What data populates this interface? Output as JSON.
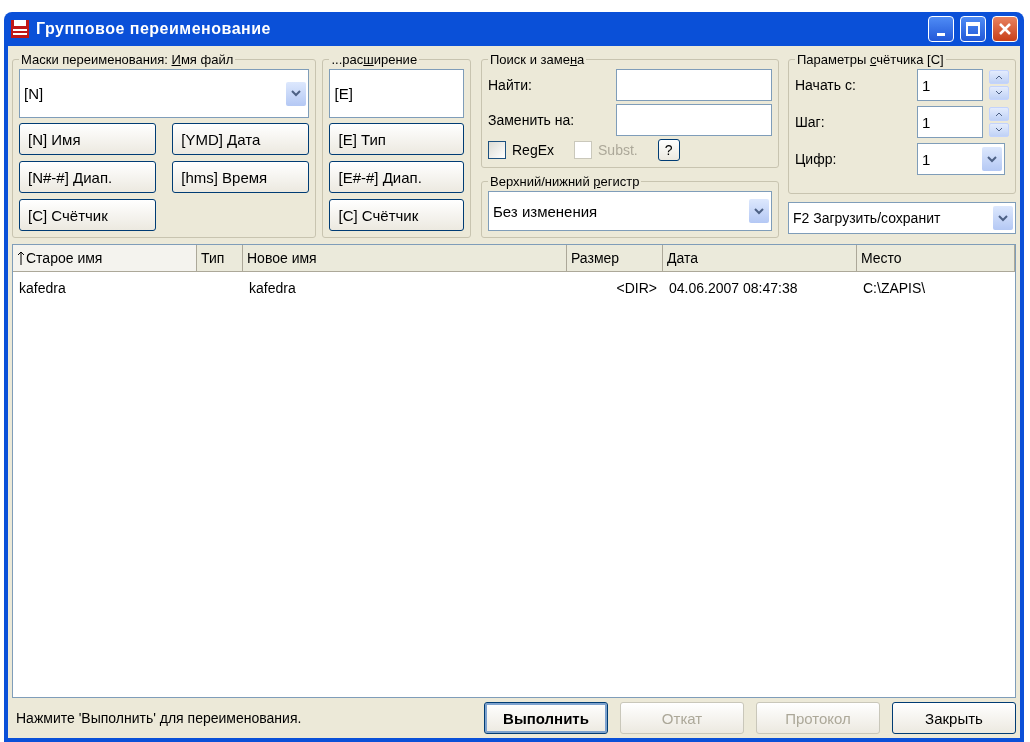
{
  "window": {
    "title": "Групповое переименование"
  },
  "mask_group": {
    "legend": {
      "before": "Маски переименования: ",
      "accel": "И",
      "after": "мя файл"
    },
    "combo_value": "[N]",
    "buttons": [
      "[N]  Имя",
      "[YMD]  Дата",
      "[N#-#] Диап.",
      "[hms] Время",
      "[C]  Счётчик"
    ]
  },
  "extension_group": {
    "legend": {
      "before": "...рас",
      "accel": "ш",
      "after": "ирение"
    },
    "field_value": "[E]",
    "buttons": [
      "[E]  Тип",
      "[E#-#] Диап.",
      "[C]  Счётчик"
    ]
  },
  "search_group": {
    "legend": {
      "before": "Поиск и заме",
      "accel": "н",
      "after": "а"
    },
    "find_label": "Найти:",
    "replace_label": "Заменить на:",
    "checkboxes": [
      {
        "label": "RegEx",
        "checked": false,
        "disabled": false
      },
      {
        "label": "Subst.",
        "checked": false,
        "disabled": true
      }
    ],
    "help_button": "?"
  },
  "case_group": {
    "legend": {
      "before": "Верхний/нижний ",
      "accel": "р",
      "after": "егистр"
    },
    "value": "Без изменения"
  },
  "counter_group": {
    "legend": {
      "before": "Параметры ",
      "accel": "с",
      "after": "чётчика [C]"
    },
    "fields": [
      {
        "label": "Начать с:",
        "value": "1",
        "kind": "spin"
      },
      {
        "label": "Шаг:",
        "value": "1",
        "kind": "spin"
      },
      {
        "label": "Цифр:",
        "value": "1",
        "kind": "combo"
      }
    ]
  },
  "preset_combo": {
    "value": "F2 Загрузить/сохранит"
  },
  "table": {
    "columns": [
      {
        "label": "Старое имя",
        "sorted": true
      },
      {
        "label": "Тип",
        "sorted": false
      },
      {
        "label": "Новое имя",
        "sorted": false
      },
      {
        "label": "Размер",
        "sorted": false
      },
      {
        "label": "Дата",
        "sorted": false
      },
      {
        "label": "Место",
        "sorted": false
      }
    ],
    "rows": [
      [
        "kafedra",
        "",
        "kafedra",
        "<DIR>",
        "04.06.2007 08:47:38",
        "C:\\ZAPIS\\"
      ]
    ]
  },
  "status_bar": {
    "text": "Нажмите 'Выполнить' для переименования.",
    "buttons": [
      {
        "label": "Выполнить",
        "default": true,
        "disabled": false
      },
      {
        "label": "Откат",
        "default": false,
        "disabled": true
      },
      {
        "label": "Протокол",
        "default": false,
        "disabled": true
      },
      {
        "label": "Закрыть",
        "default": false,
        "disabled": false
      }
    ]
  }
}
